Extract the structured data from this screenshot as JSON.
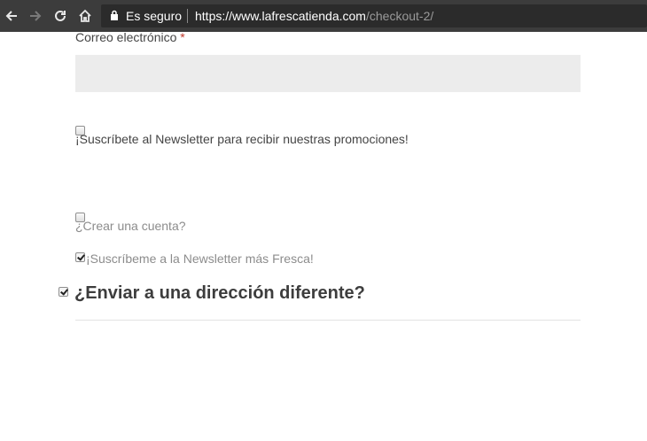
{
  "browser": {
    "secure_label": "Es seguro",
    "url_host": "https://www.lafrescatienda.com",
    "url_path": "/checkout-2/"
  },
  "form": {
    "email_label": "Correo electrónico",
    "required_mark": "*",
    "email_value": "",
    "newsletter_label": "¡Suscríbete al Newsletter para recibir nuestras promociones!",
    "newsletter_checked": false,
    "create_account_label": "¿Crear una cuenta?",
    "create_account_checked": false,
    "fresca_newsletter_label": "¡Suscríbeme a la Newsletter más Fresca!",
    "fresca_newsletter_checked": true,
    "ship_different_label": "¿Enviar a una dirección diferente?",
    "ship_different_checked": true
  }
}
